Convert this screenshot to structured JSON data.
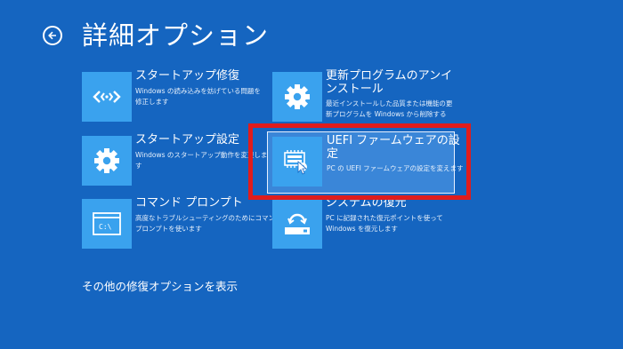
{
  "header": {
    "title": "詳細オプション"
  },
  "options": [
    {
      "title": "スタートアップ修復",
      "desc_lines": [
        "Windows の読み込みを妨げている問題を",
        "修正します"
      ]
    },
    {
      "title": "スタートアップ設定",
      "desc_lines": [
        "Windows のスタートアップ動作を変更しま",
        "す"
      ]
    },
    {
      "title": "コマンド プロンプト",
      "desc_lines": [
        "高度なトラブルシューティングのためにコマンド",
        "プロンプトを使います"
      ]
    },
    {
      "title_lines": [
        "更新プログラムのアンイ",
        "ンストール"
      ],
      "desc_lines": [
        "最近インストールした品質または機能の更",
        "新プログラムを Windows から削除する"
      ]
    },
    {
      "title_lines": [
        "UEFI ファームウェアの設",
        "定"
      ],
      "desc_lines": [
        "PC の UEFI ファームウェアの設定を変えます"
      ]
    },
    {
      "title": "システムの復元",
      "desc_lines": [
        "PC に記録された復元ポイントを使って",
        "Windows を復元します"
      ]
    }
  ],
  "footer": {
    "more_options_link": "その他の修復オプションを表示"
  },
  "icons": {
    "back": "back-arrow-icon",
    "startup_repair": "code-brackets-icon",
    "startup_settings": "gear-icon",
    "command_prompt": "console-window-icon",
    "console_text": "C:\\",
    "uninstall_updates": "gear-icon",
    "uefi": "firmware-chip-icon",
    "system_restore": "restore-icon"
  },
  "colors": {
    "background": "#1565C0",
    "tile": "#3AA2EE",
    "selected": "#3A86D8",
    "highlight": "#E01C1C"
  }
}
